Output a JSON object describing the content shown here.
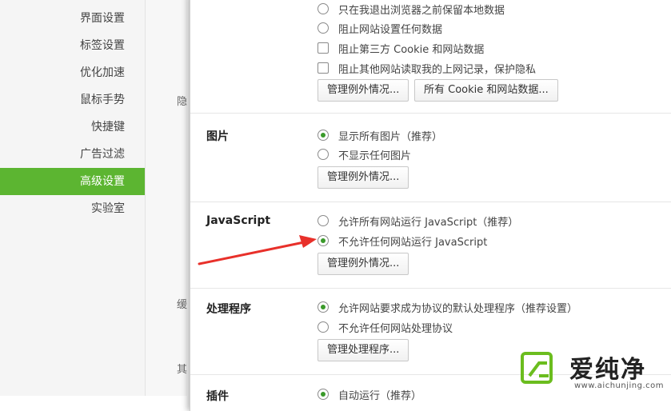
{
  "sidebar": {
    "items": [
      {
        "label": "界面设置",
        "active": false
      },
      {
        "label": "标签设置",
        "active": false
      },
      {
        "label": "优化加速",
        "active": false
      },
      {
        "label": "鼠标手势",
        "active": false
      },
      {
        "label": "快捷键",
        "active": false
      },
      {
        "label": "广告过滤",
        "active": false
      },
      {
        "label": "高级设置",
        "active": true
      },
      {
        "label": "实验室",
        "active": false
      }
    ]
  },
  "strip_labels": [
    "隐",
    "缓",
    "其"
  ],
  "cookies": {
    "options": [
      {
        "type": "radio",
        "checked": false,
        "label": "只在我退出浏览器之前保留本地数据"
      },
      {
        "type": "radio",
        "checked": false,
        "label": "阻止网站设置任何数据"
      },
      {
        "type": "checkbox",
        "checked": false,
        "label": "阻止第三方 Cookie 和网站数据"
      },
      {
        "type": "checkbox",
        "checked": false,
        "label": "阻止其他网站读取我的上网记录，保护隐私"
      }
    ],
    "manage_exceptions": "管理例外情况...",
    "all_cookies": "所有 Cookie 和网站数据..."
  },
  "images": {
    "title": "图片",
    "options": [
      {
        "checked": true,
        "label": "显示所有图片（推荐）"
      },
      {
        "checked": false,
        "label": "不显示任何图片"
      }
    ],
    "manage_exceptions": "管理例外情况..."
  },
  "javascript": {
    "title": "JavaScript",
    "options": [
      {
        "checked": false,
        "label": "允许所有网站运行 JavaScript（推荐）"
      },
      {
        "checked": true,
        "label": "不允许任何网站运行 JavaScript"
      }
    ],
    "manage_exceptions": "管理例外情况..."
  },
  "handlers": {
    "title": "处理程序",
    "options": [
      {
        "checked": true,
        "label": "允许网站要求成为协议的默认处理程序（推荐设置）"
      },
      {
        "checked": false,
        "label": "不允许任何网站处理协议"
      }
    ],
    "manage_button": "管理处理程序..."
  },
  "plugins": {
    "title": "插件",
    "options": [
      {
        "checked": true,
        "label": "自动运行（推荐）"
      }
    ]
  },
  "annotation": {
    "arrow_color": "#e8302a"
  },
  "watermark": {
    "text": "爱纯净",
    "url": "www.aichunjing.com",
    "accent": "#6bbd1e"
  },
  "colors": {
    "accent": "#5cb531",
    "radio_dot": "#3a9a2a"
  }
}
